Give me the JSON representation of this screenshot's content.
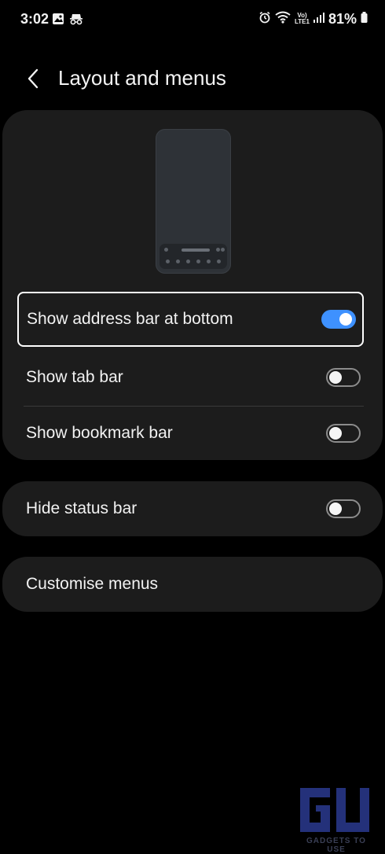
{
  "status_bar": {
    "time": "3:02",
    "battery": "81%",
    "network_label_top": "Vo)",
    "network_label_bottom": "LTE1",
    "icons": [
      "image-icon",
      "incognito-icon",
      "alarm-icon",
      "wifi-icon",
      "signal-icon",
      "battery-icon"
    ]
  },
  "header": {
    "title": "Layout and menus",
    "back_icon": "back-chevron-icon"
  },
  "settings": {
    "address_bar": {
      "label": "Show address bar at bottom",
      "enabled": true
    },
    "tab_bar": {
      "label": "Show tab bar",
      "enabled": false
    },
    "bookmark_bar": {
      "label": "Show bookmark bar",
      "enabled": false
    },
    "status_bar": {
      "label": "Hide status bar",
      "enabled": false
    },
    "customise_menus": {
      "label": "Customise menus"
    }
  },
  "watermark": {
    "logo_text": "GU",
    "text": "GADGETS TO USE"
  },
  "colors": {
    "background": "#000000",
    "card": "#1c1c1c",
    "accent": "#3e91ff",
    "text": "#f2f2f2"
  }
}
